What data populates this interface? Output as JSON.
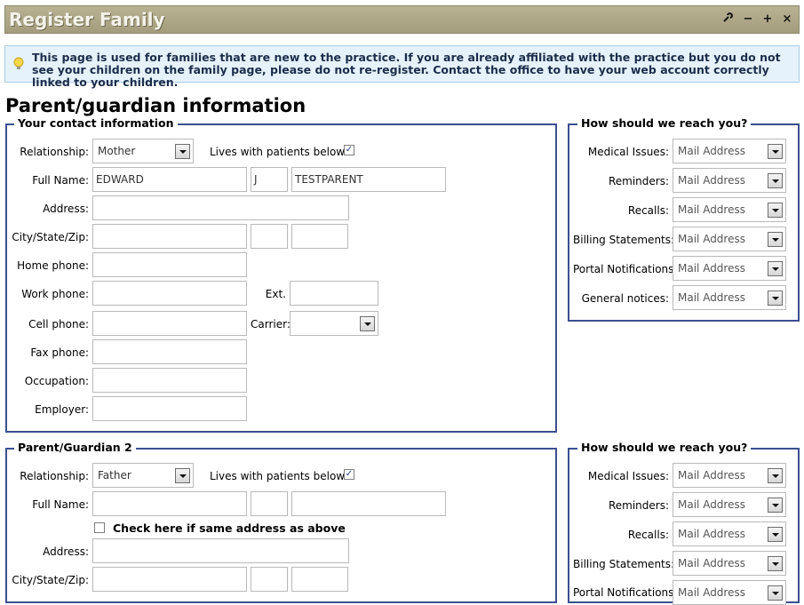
{
  "window": {
    "title": "Register Family",
    "controls": {
      "pin": "wrench",
      "minimize": "−",
      "maximize": "+",
      "close": "×"
    }
  },
  "notice": {
    "icon": "lightbulb-icon",
    "text": "This page is used for families that are new to the practice. If you are already affiliated with the practice but you do not see your children on the family page, please do not re-register. Contact the office to have your web account correctly linked to your children."
  },
  "section_title": "Parent/guardian information",
  "contact": {
    "legend": "Your contact information",
    "relationship_label": "Relationship:",
    "relationship_value": "Mother",
    "lives_with_label": "Lives with patients below?",
    "lives_with_checked": true,
    "fullname_label": "Full Name:",
    "first_name": "EDWARD",
    "middle_initial": "J",
    "last_name": "TESTPARENT",
    "address_label": "Address:",
    "csz_label": "City/State/Zip:",
    "home_label": "Home phone:",
    "work_label": "Work phone:",
    "ext_label": "Ext.",
    "cell_label": "Cell phone:",
    "carrier_label": "Carrier:",
    "fax_label": "Fax phone:",
    "occupation_label": "Occupation:",
    "employer_label": "Employer:"
  },
  "reach1": {
    "legend": "How should we reach you?",
    "rows": [
      {
        "label": "Medical Issues:",
        "value": "Mail Address"
      },
      {
        "label": "Reminders:",
        "value": "Mail Address"
      },
      {
        "label": "Recalls:",
        "value": "Mail Address"
      },
      {
        "label": "Billing Statements:",
        "value": "Mail Address"
      },
      {
        "label": "Portal Notifications:",
        "value": "Mail Address"
      },
      {
        "label": "General notices:",
        "value": "Mail Address"
      }
    ]
  },
  "guardian2": {
    "legend": "Parent/Guardian 2",
    "relationship_label": "Relationship:",
    "relationship_value": "Father",
    "lives_with_label": "Lives with patients below?",
    "lives_with_checked": true,
    "fullname_label": "Full Name:",
    "same_address_label": "Check here if same address as above",
    "address_label": "Address:",
    "csz_label": "City/State/Zip:"
  },
  "reach2": {
    "legend": "How should we reach you?",
    "rows": [
      {
        "label": "Medical Issues:",
        "value": "Mail Address"
      },
      {
        "label": "Reminders:",
        "value": "Mail Address"
      },
      {
        "label": "Recalls:",
        "value": "Mail Address"
      },
      {
        "label": "Billing Statements:",
        "value": "Mail Address"
      },
      {
        "label": "Portal Notifications:",
        "value": "Mail Address"
      }
    ]
  },
  "colors": {
    "titlebar": "#a9a385",
    "fieldset_border": "#3d4f8f",
    "notice_bg": "#e6f2fb"
  }
}
